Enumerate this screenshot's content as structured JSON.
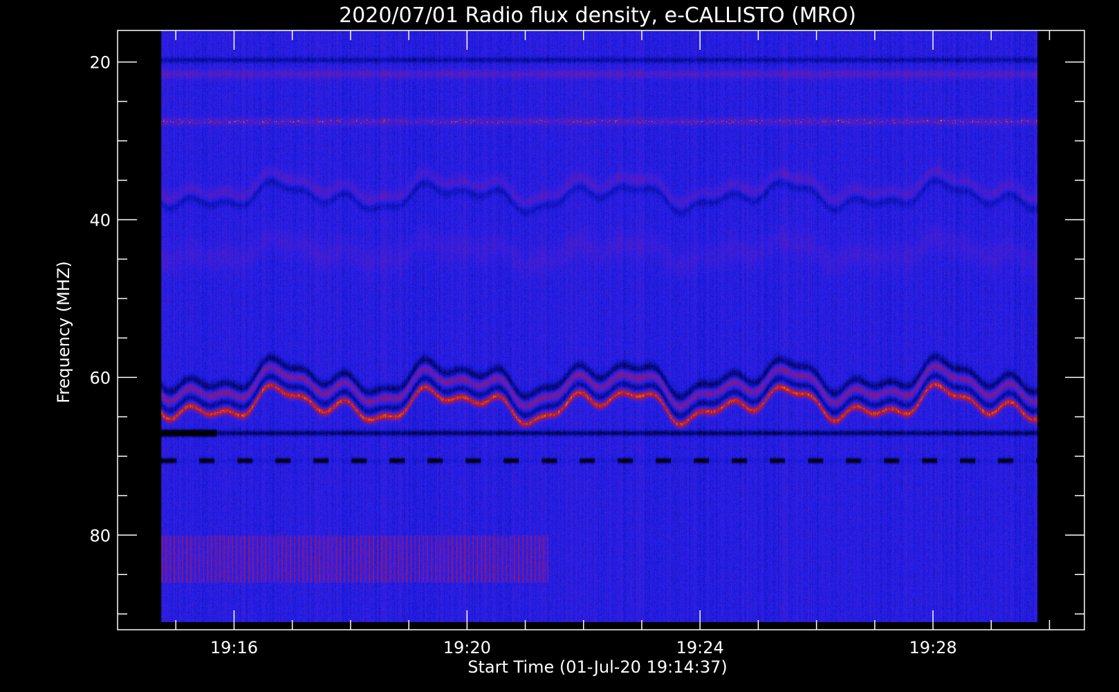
{
  "chart_data": {
    "type": "heatmap",
    "title": "2020/07/01  Radio flux density, e-CALLISTO (MRO)",
    "xlabel": "Start Time (01-Jul-20 19:14:37)",
    "ylabel": "Frequency (MHZ)",
    "x_tick_labels": [
      "19:16",
      "19:20",
      "19:24",
      "19:28"
    ],
    "x_tick_minutes": [
      16,
      20,
      24,
      28
    ],
    "y_tick_labels": [
      "20",
      "40",
      "60",
      "80"
    ],
    "y_ticks": [
      20,
      40,
      60,
      80
    ],
    "xlim_minutes": [
      14.0,
      30.6
    ],
    "ylim": [
      16,
      92
    ],
    "data_time_range_minutes": [
      14.75,
      29.8
    ],
    "data_freq_range": [
      16,
      91
    ],
    "grid": false,
    "colormap": [
      "#000000",
      "#0a0a8c",
      "#2020f0",
      "#6a1ab0",
      "#c01818",
      "#ff7a00",
      "#ffe080"
    ],
    "features": [
      {
        "kind": "emission-band",
        "freq": 27.5,
        "note": "intermittent bright spots"
      },
      {
        "kind": "emission-band",
        "freq": 21.5
      },
      {
        "kind": "wavy-band",
        "freq": 36
      },
      {
        "kind": "wavy-band",
        "freq": 61
      },
      {
        "kind": "wavy-band",
        "freq": 63.5,
        "note": "bright red ridge"
      },
      {
        "kind": "dark-line",
        "freq": 67
      },
      {
        "kind": "dashed-dark-line",
        "freq": 70.5
      },
      {
        "kind": "red-striations",
        "freq": 83.5
      }
    ]
  }
}
